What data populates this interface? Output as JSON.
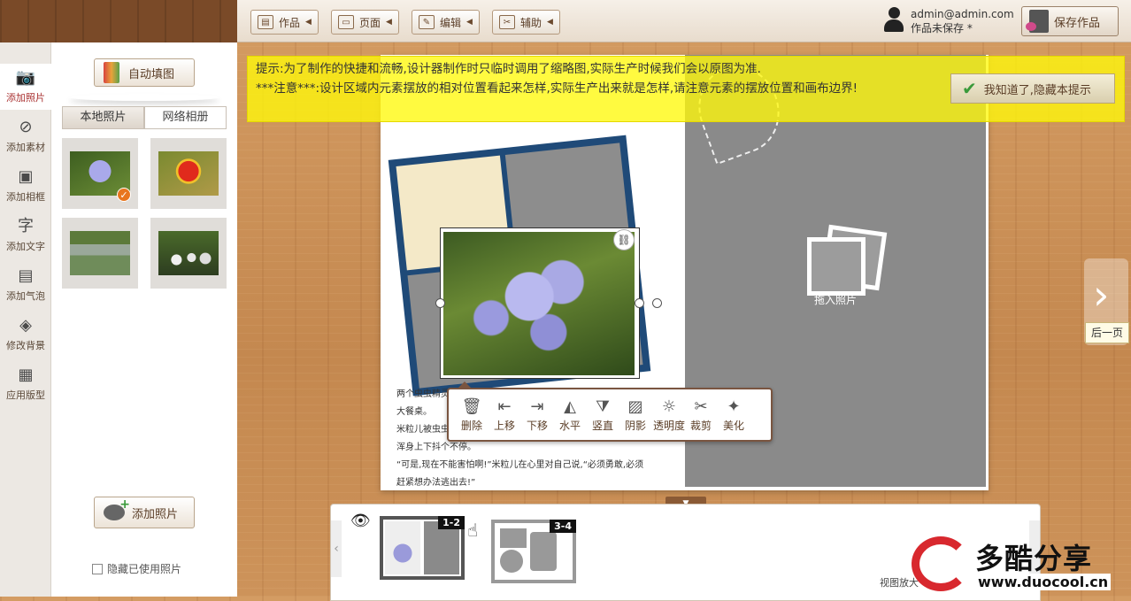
{
  "toolbar": {
    "menus": [
      {
        "label": "作品",
        "icon": "book-icon"
      },
      {
        "label": "页面",
        "icon": "page-icon"
      },
      {
        "label": "编辑",
        "icon": "edit-icon"
      },
      {
        "label": "辅助",
        "icon": "tools-icon"
      }
    ],
    "user_email": "admin@admin.com",
    "save_status": "作品未保存",
    "save_status_mark": "*",
    "save_label": "保存作品"
  },
  "leftnav": {
    "items": [
      {
        "label": "添加照片",
        "icon": "camera-icon",
        "active": true
      },
      {
        "label": "添加素材",
        "icon": "material-icon",
        "active": false
      },
      {
        "label": "添加相框",
        "icon": "frame-icon",
        "active": false
      },
      {
        "label": "添加文字",
        "icon": "text-icon",
        "active": false
      },
      {
        "label": "添加气泡",
        "icon": "bubble-icon",
        "active": false
      },
      {
        "label": "修改背景",
        "icon": "paint-bucket-icon",
        "active": false
      },
      {
        "label": "应用版型",
        "icon": "layout-icon",
        "active": false
      }
    ]
  },
  "photos": {
    "auto_fill_label": "自动填图",
    "tabs": [
      "本地照片",
      "网络相册"
    ],
    "active_tab": "本地照片",
    "add_photo_label": "添加照片",
    "hide_used_label": "隐藏已使用照片"
  },
  "notice": {
    "line1": "提示:为了制作的快捷和流畅,设计器制作时只临时调用了缩略图,实际生产时候我们会以原图为准.",
    "line2": "***注意***:设计区域内元素摆放的相对位置看起来怎样,实际生产出来就是怎样,请注意元素的摆放位置和画布边界!",
    "ack_label": "我知道了,隐藏本提示"
  },
  "canvas": {
    "drop_label": "拖入照片",
    "text_lines": [
      "两个虫虫精灵",
      "大餐桌。",
      "米粒儿被虫虫",
      "浑身上下抖个不停。",
      "“可是,现在不能害怕啊!”米粒儿在心里对自己说,“必须勇敢,必须",
      "赶紧想办法逃出去!”"
    ]
  },
  "photo_tools": [
    {
      "label": "删除",
      "icon": "trash-icon"
    },
    {
      "label": "上移",
      "icon": "move-up-icon"
    },
    {
      "label": "下移",
      "icon": "move-down-icon"
    },
    {
      "label": "水平",
      "icon": "flip-horizontal-icon"
    },
    {
      "label": "竖直",
      "icon": "flip-vertical-icon"
    },
    {
      "label": "阴影",
      "icon": "shadow-icon"
    },
    {
      "label": "透明度",
      "icon": "opacity-icon"
    },
    {
      "label": "裁剪",
      "icon": "crop-icon"
    },
    {
      "label": "美化",
      "icon": "magic-wand-icon"
    }
  ],
  "nav": {
    "next_label": "后一页"
  },
  "pages": {
    "thumbs": [
      {
        "num": "1-2",
        "selected": true
      },
      {
        "num": "3-4",
        "selected": false
      }
    ],
    "zoom_label": "视图放大"
  },
  "watermark": {
    "brand": "多酷分享",
    "url": "www.duocool.cn"
  }
}
